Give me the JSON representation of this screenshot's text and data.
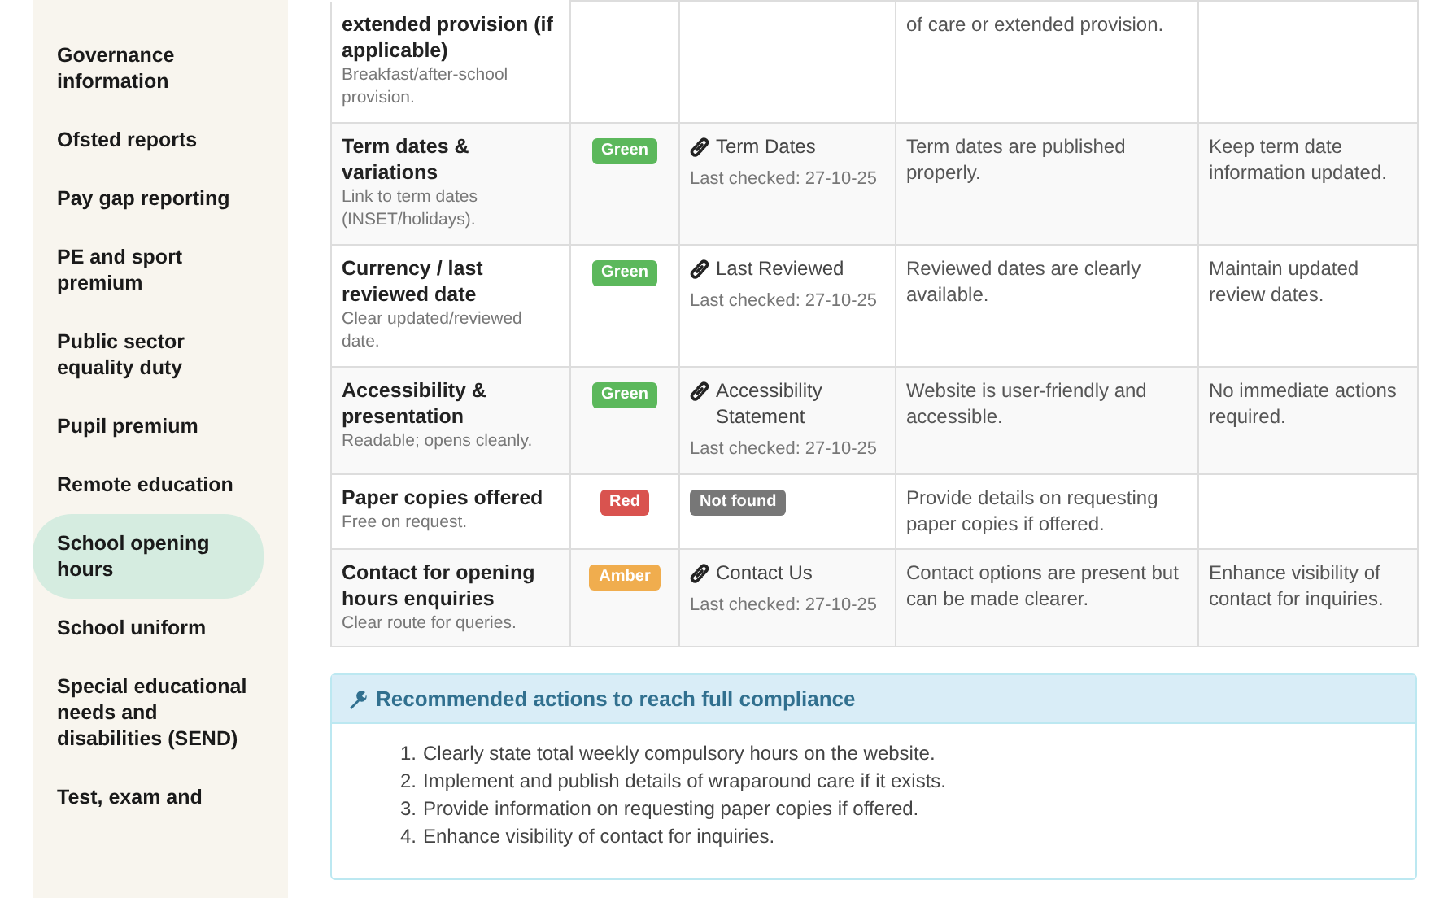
{
  "sidebar": {
    "items": [
      {
        "label": "Governance information",
        "selected": false
      },
      {
        "label": "Ofsted reports",
        "selected": false
      },
      {
        "label": "Pay gap reporting",
        "selected": false
      },
      {
        "label": "PE and sport premium",
        "selected": false
      },
      {
        "label": "Public sector equality duty",
        "selected": false
      },
      {
        "label": "Pupil premium",
        "selected": false
      },
      {
        "label": "Remote education",
        "selected": false
      },
      {
        "label": "School opening hours",
        "selected": true
      },
      {
        "label": "School uniform",
        "selected": false
      },
      {
        "label": "Special educational needs and disabilities (SEND)",
        "selected": false
      },
      {
        "label": "Test, exam and",
        "selected": false
      }
    ]
  },
  "table": {
    "rows": [
      {
        "title": "extended provision (if applicable)",
        "note": "Breakfast/after-school provision.",
        "finding": "of care or extended provision."
      },
      {
        "title": "Term dates & variations",
        "note": "Link to term dates (INSET/holidays).",
        "status": {
          "label": "Green",
          "kind": "green"
        },
        "evidence": {
          "kind": "link",
          "label": "Term Dates",
          "checked": "Last checked: 27-10-25"
        },
        "finding": "Term dates are published properly.",
        "action": "Keep term date information updated."
      },
      {
        "title": "Currency / last reviewed date",
        "note": "Clear updated/reviewed date.",
        "status": {
          "label": "Green",
          "kind": "green"
        },
        "evidence": {
          "kind": "link",
          "label": "Last Reviewed",
          "checked": "Last checked: 27-10-25"
        },
        "finding": "Reviewed dates are clearly available.",
        "action": "Maintain updated review dates."
      },
      {
        "title": "Accessibility & presentation",
        "note": "Readable; opens cleanly.",
        "status": {
          "label": "Green",
          "kind": "green"
        },
        "evidence": {
          "kind": "link",
          "label": "Accessibility Statement",
          "checked": "Last checked: 27-10-25"
        },
        "finding": "Website is user-friendly and accessible.",
        "action": "No immediate actions required."
      },
      {
        "title": "Paper copies offered",
        "note": "Free on request.",
        "status": {
          "label": "Red",
          "kind": "red"
        },
        "evidence": {
          "kind": "missing",
          "label": "Not found"
        },
        "finding": "Provide details on requesting paper copies if offered."
      },
      {
        "title": "Contact for opening hours enquiries",
        "note": "Clear route for queries.",
        "status": {
          "label": "Amber",
          "kind": "amber"
        },
        "evidence": {
          "kind": "link",
          "label": "Contact Us",
          "checked": "Last checked: 27-10-25"
        },
        "finding": "Contact options are present but can be made clearer.",
        "action": "Enhance visibility of contact for inquiries."
      }
    ]
  },
  "actions_panel": {
    "title": "Recommended actions to reach full compliance",
    "items": [
      {
        "number": "1.",
        "text": "Clearly state total weekly compulsory hours on the website."
      },
      {
        "number": "2.",
        "text": "Implement and publish details of wraparound care if it exists."
      },
      {
        "number": "3.",
        "text": "Provide information on requesting paper copies if offered."
      },
      {
        "number": "4.",
        "text": "Enhance visibility of contact for inquiries."
      }
    ]
  }
}
